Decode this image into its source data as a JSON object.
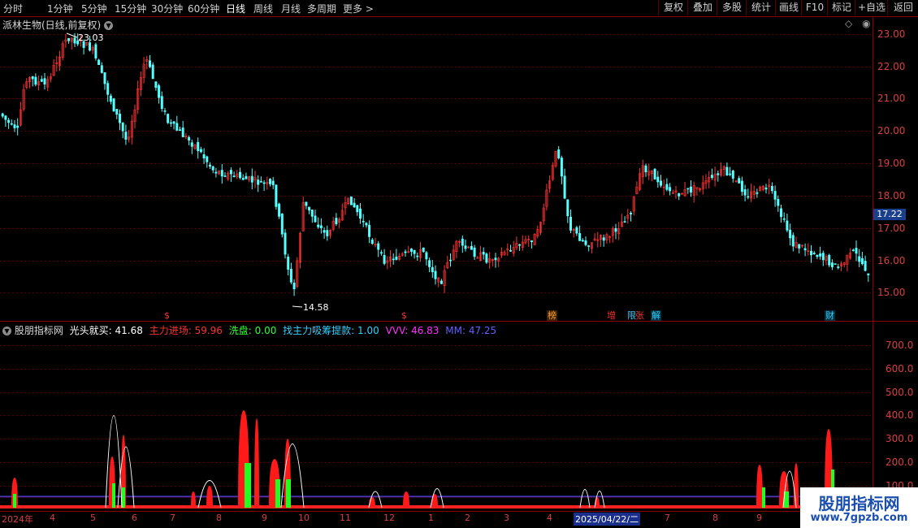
{
  "toolbar": {
    "periods": [
      "分时",
      "1分钟",
      "5分钟",
      "15分钟",
      "30分钟",
      "60分钟",
      "日线",
      "周线",
      "月线",
      "多周期",
      "更多 >"
    ],
    "active_period": "日线",
    "right_buttons": [
      "复权",
      "叠加",
      "多股",
      "统计",
      "画线",
      "F10",
      "标记",
      "+自选",
      "返回"
    ]
  },
  "price_panel": {
    "title": "派林生物(日线,前复权)",
    "max_label": "23.03",
    "min_label": "14.58",
    "current_price": "17.22",
    "axis_ticks": [
      "23.00",
      "22.00",
      "21.00",
      "20.00",
      "19.00",
      "18.00",
      "17.00",
      "16.00",
      "15.00"
    ],
    "event_badges": [
      {
        "text": "$",
        "color": "#ff3030"
      },
      {
        "text": "$",
        "color": "#ff3030"
      },
      {
        "text": "榜",
        "color": "#ffa030"
      },
      {
        "text": "增",
        "color": "#ff3030"
      },
      {
        "text": "限",
        "color": "#30d0ff"
      },
      {
        "text": "张",
        "color": "#ff3030"
      },
      {
        "text": "解",
        "color": "#30d0ff"
      },
      {
        "text": "财",
        "color": "#30d0ff"
      }
    ],
    "colors": {
      "up": "#ff3232",
      "down": "#54ffff",
      "grid": "#5a0000"
    }
  },
  "indicator_panel": {
    "name": "股朋指标网",
    "items": [
      {
        "label": "光头就买: 41.68",
        "color": "#ffffff"
      },
      {
        "label": "主力进场: 59.96",
        "color": "#ff3030"
      },
      {
        "label": "洗盘: 0.00",
        "color": "#30ff30"
      },
      {
        "label": "找主力吸筹提款: 1.00",
        "color": "#30d0ff"
      },
      {
        "label": "VVV: 46.83",
        "color": "#ff30ff"
      },
      {
        "label": "MM: 47.25",
        "color": "#6060ff"
      }
    ],
    "axis_ticks": [
      "700.0",
      "600.0",
      "500.0",
      "400.0",
      "300.0",
      "200.0",
      "100.0"
    ]
  },
  "date_axis": {
    "labels": [
      "2024年",
      "4",
      "5",
      "6",
      "7",
      "8",
      "9",
      "10",
      "11",
      "12",
      "1",
      "2",
      "3",
      "4",
      "2025/04/22/二",
      "7",
      "8",
      "9"
    ]
  },
  "watermark": {
    "title": "股朋指标网",
    "url": "www.7gpzb.com"
  }
}
